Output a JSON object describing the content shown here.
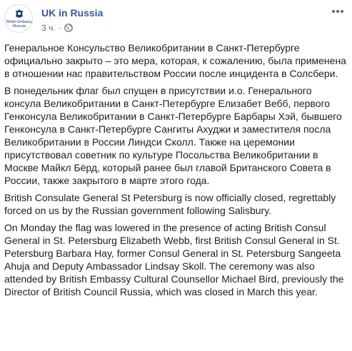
{
  "post": {
    "page_name": "UK in Russia",
    "avatar_logo_text": "British Embassy Moscow",
    "timestamp": "3 ч.",
    "separator": "·",
    "privacy_icon": "globe-icon",
    "more_icon": "more-horizontal-icon",
    "paragraphs": [
      "Генеральное Консульство Великобритании в Санкт-Петербурге официально закрыто – это мера, которая, к сожалению, была применена в отношении нас правительством России после инцидента в Солсбери.",
      "В понедельник флаг был спущен в присутствии и.о. Генерального консула Великобритании в Санкт-Петербурге Елизабет Вебб, первого Генконсула Великобритании в Санкт-Петербурге Барбары Хэй, бывшего Генконсула в Санкт-Петербурге Сангиты Ахуджи и заместителя посла Великобритании в России Линдси Сколл. Также на церемонии присутствовал советник по культуре Посольства Великобритании в Москве Майкл Бёрд, который ранее был главой Британского Совета в России, также закрытого в марте этого года.",
      "British Consulate General St Petersburg is now officially closed, regrettably forced on us by the Russian government following Salisbury.",
      "On Monday the flag was lowered in the presence of acting British Consul General in St. Petersburg Elizabeth Webb, first British Consul General in St. Petersburg Barbara Hay, former Consul General in St. Petersburg Sangeeta Ahuja and Deputy Ambassador Lindsay Skoll. The ceremony was also attended by British Embassy Cultural Counsellor Michael Bird, previously the Director of British Council Russia, which was closed in March this year."
    ]
  },
  "colors": {
    "page_name": "#385898",
    "meta": "#616770",
    "text": "#1c1e21",
    "crest": "#1d3f72"
  }
}
